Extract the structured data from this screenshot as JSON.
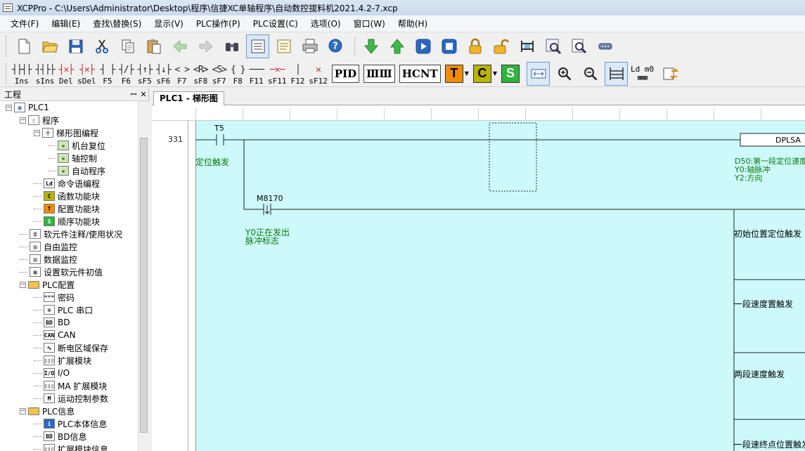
{
  "window": {
    "title": "XCPPro - C:\\Users\\Administrator\\Desktop\\程序\\信捷XC单轴程序\\自动数控拔料机2021.4.2-7.xcp"
  },
  "menubar": {
    "items": [
      "文件(F)",
      "编辑(E)",
      "查找\\替换(S)",
      "显示(V)",
      "PLC操作(P)",
      "PLC设置(C)",
      "选项(O)",
      "窗口(W)",
      "帮助(H)"
    ]
  },
  "toolbar1": {
    "icons": [
      "new-file-icon",
      "open-folder-icon",
      "save-icon",
      "cut-icon",
      "copy-icon",
      "paste-icon",
      "back-arrow-icon",
      "forward-arrow-icon",
      "find-icon",
      "ladder-view-icon",
      "instruction-list-icon",
      "print-icon",
      "help-icon",
      "download-icon",
      "upload-icon",
      "run-icon",
      "stop-icon",
      "lock-icon",
      "unlock-icon",
      "monitor-icon",
      "zoom-monitor-icon",
      "search-monitor-icon",
      "serial-port-icon"
    ]
  },
  "toolbar2": {
    "items": [
      {
        "sym": "┤├┤├",
        "label": "Ins"
      },
      {
        "sym": "┤┤├├",
        "label": "sIns"
      },
      {
        "sym": "┤✕├",
        "label": "Del"
      },
      {
        "sym": "┤✕├",
        "label": "sDel"
      },
      {
        "sym": "┤ ├",
        "label": "F5"
      },
      {
        "sym": "┤/├",
        "label": "F6"
      },
      {
        "sym": "┤↑├",
        "label": "sF5"
      },
      {
        "sym": "┤↓├",
        "label": "sF6"
      },
      {
        "sym": "< >",
        "label": "F7"
      },
      {
        "sym": "<R>",
        "label": "sF8"
      },
      {
        "sym": "<S>",
        "label": "sF7"
      },
      {
        "sym": "{ }",
        "label": "F8"
      },
      {
        "sym": "───",
        "label": "F11"
      },
      {
        "sym": "─✕─",
        "label": "sF11"
      },
      {
        "sym": "│",
        "label": "F12"
      },
      {
        "sym": "✕",
        "label": "sF12"
      }
    ],
    "big_buttons": [
      "PID",
      "ⅢⅢ",
      "HCNT"
    ],
    "letter_buttons": [
      {
        "letter": "T",
        "color": "#f08c00"
      },
      {
        "letter": "C",
        "color": "#b9b400"
      },
      {
        "letter": "S",
        "color": "#2fb53a"
      }
    ],
    "ld_label": "Ld m0"
  },
  "project": {
    "header": "工程",
    "pin": "ꟷ",
    "close": "✕",
    "tree": [
      {
        "label": "PLC1",
        "level": 0,
        "expander": "⊟",
        "icon": "plc"
      },
      {
        "label": "程序",
        "level": 1,
        "expander": "⊟",
        "icon": "doc"
      },
      {
        "label": "梯形图编程",
        "level": 2,
        "expander": "⊟",
        "icon": "ladder"
      },
      {
        "label": "机台复位",
        "level": 3,
        "icon": "sub"
      },
      {
        "label": "轴控制",
        "level": 3,
        "icon": "sub"
      },
      {
        "label": "自动程序",
        "level": 3,
        "icon": "sub"
      },
      {
        "label": "命令语编程",
        "level": 2,
        "icon": "ld"
      },
      {
        "label": "函数功能块",
        "level": 2,
        "icon": "C"
      },
      {
        "label": "配置功能块",
        "level": 2,
        "icon": "T"
      },
      {
        "label": "顺序功能块",
        "level": 2,
        "icon": "S"
      },
      {
        "label": "软元件注释/使用状况",
        "level": 1,
        "icon": "list"
      },
      {
        "label": "自由监控",
        "level": 1,
        "icon": "mon"
      },
      {
        "label": "数据监控",
        "level": 1,
        "icon": "mon"
      },
      {
        "label": "设置软元件初值",
        "level": 1,
        "icon": "grid"
      },
      {
        "label": "PLC配置",
        "level": 1,
        "expander": "⊟",
        "icon": "folder"
      },
      {
        "label": "密码",
        "level": 2,
        "icon": "pw"
      },
      {
        "label": "PLC 串口",
        "level": 2,
        "icon": "serial"
      },
      {
        "label": "BD",
        "level": 2,
        "icon": "BD"
      },
      {
        "label": "CAN",
        "level": 2,
        "icon": "CAN"
      },
      {
        "label": "断电区域保存",
        "level": 2,
        "icon": "wave"
      },
      {
        "label": "扩展模块",
        "level": 2,
        "icon": "ext"
      },
      {
        "label": "I/O",
        "level": 2,
        "icon": "IO"
      },
      {
        "label": "MA 扩展模块",
        "level": 2,
        "icon": "ext"
      },
      {
        "label": "运动控制参数",
        "level": 2,
        "icon": "M"
      },
      {
        "label": "PLC信息",
        "level": 1,
        "expander": "⊟",
        "icon": "folder"
      },
      {
        "label": "PLC本体信息",
        "level": 2,
        "icon": "info"
      },
      {
        "label": "BD信息",
        "level": 2,
        "icon": "BD"
      },
      {
        "label": "扩展模块信息",
        "level": 2,
        "icon": "ext"
      }
    ]
  },
  "editor": {
    "tab": "PLC1 - 梯形图",
    "line_number": "331",
    "contacts": [
      {
        "name": "T5",
        "comment": "定位触发"
      },
      {
        "name": "M8170",
        "comment_lines": [
          "Y0正在发出",
          "脉冲标志"
        ]
      }
    ],
    "instruction": {
      "name": "DPLSA",
      "comments": [
        "D50:第一段定位速度",
        "Y0:轴脉冲",
        "Y2:方向"
      ]
    },
    "branch_labels": [
      "初始位置定位触发",
      "一段速度置触发",
      "两段速度触发",
      "一段速终点位置触发"
    ]
  }
}
